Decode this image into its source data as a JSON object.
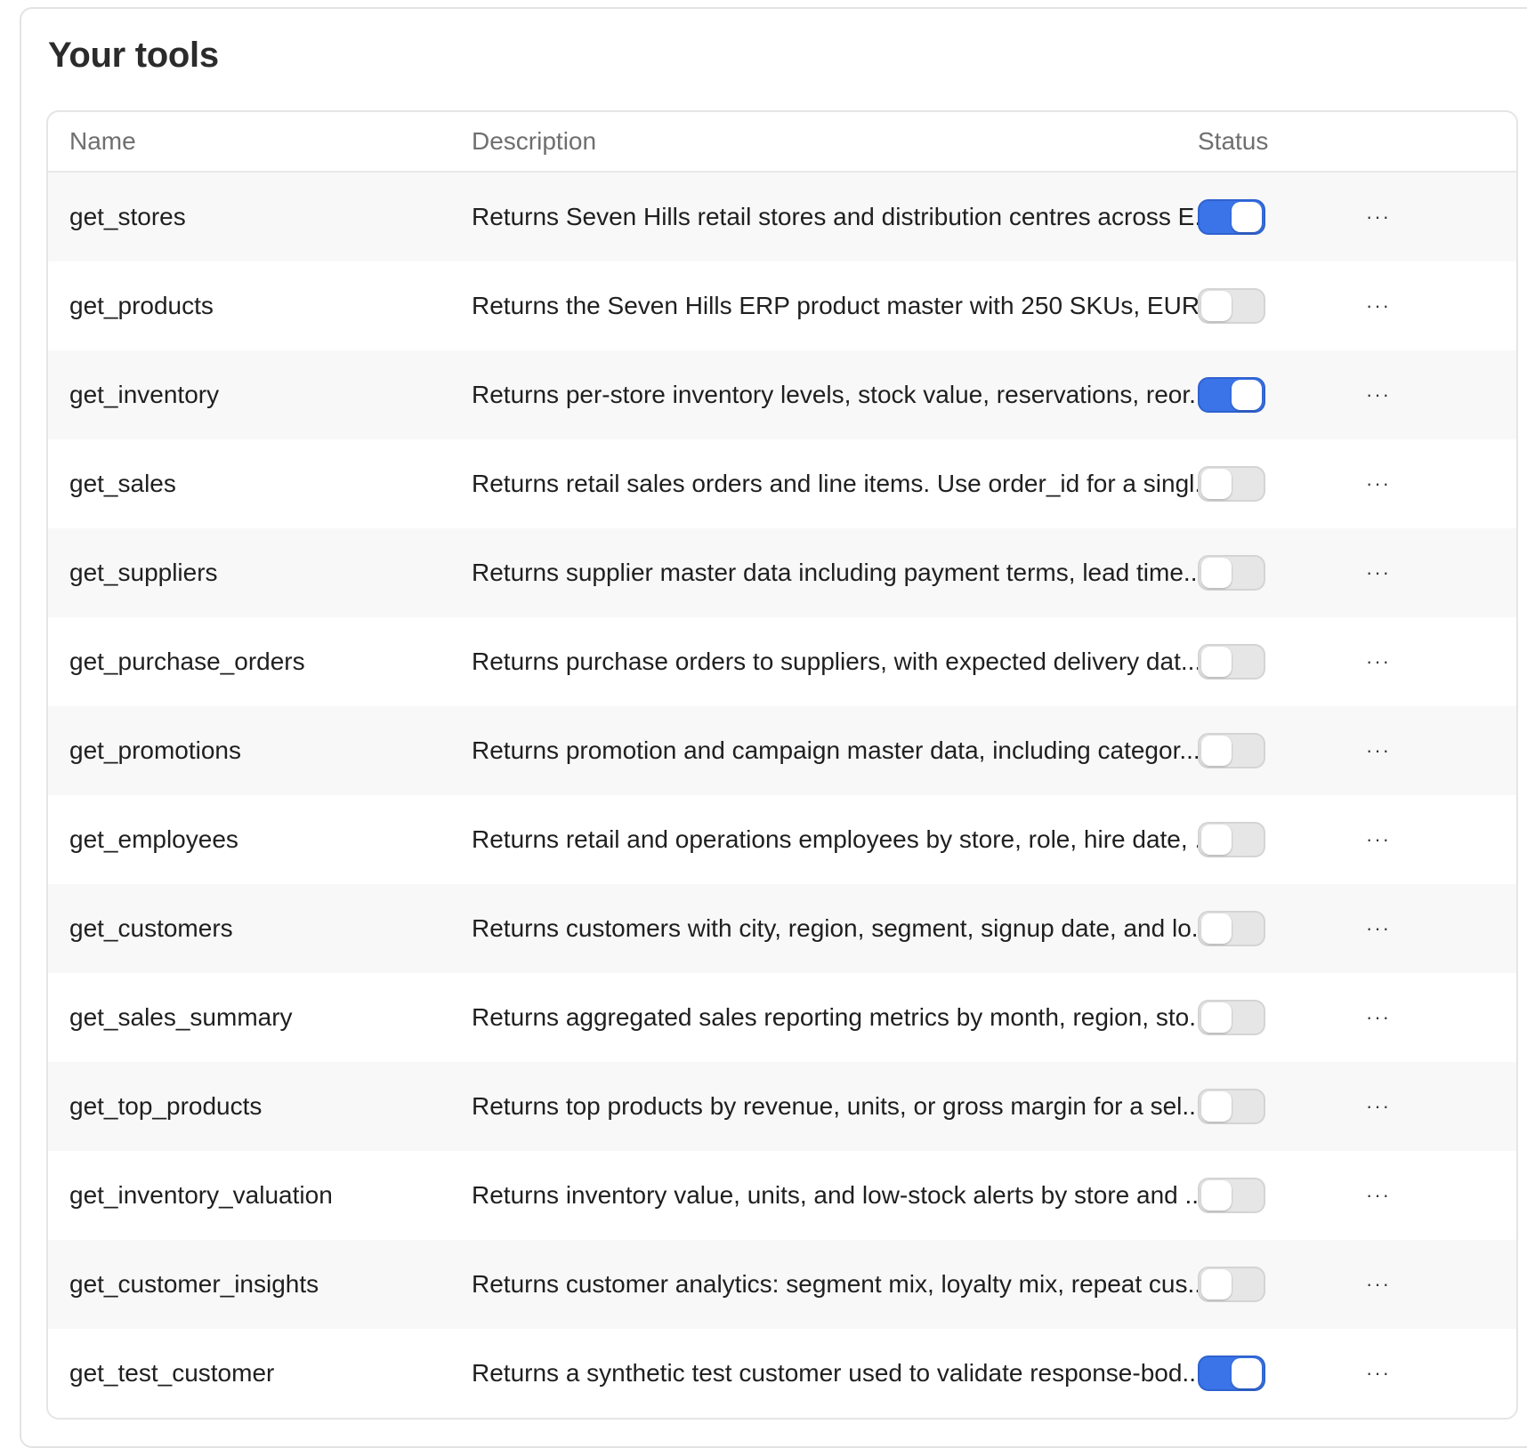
{
  "title": "Your tools",
  "columns": {
    "name": "Name",
    "description": "Description",
    "status": "Status"
  },
  "more_glyph": "···",
  "accent_color": "#3b73e8",
  "tools": [
    {
      "name": "get_stores",
      "description": "Returns Seven Hills retail stores and distribution centres across E...",
      "enabled": true
    },
    {
      "name": "get_products",
      "description": "Returns the Seven Hills ERP product master with 250 SKUs, EUR ...",
      "enabled": false
    },
    {
      "name": "get_inventory",
      "description": "Returns per-store inventory levels, stock value, reservations, reor...",
      "enabled": true
    },
    {
      "name": "get_sales",
      "description": "Returns retail sales orders and line items. Use order_id for a singl...",
      "enabled": false
    },
    {
      "name": "get_suppliers",
      "description": "Returns supplier master data including payment terms, lead time...",
      "enabled": false
    },
    {
      "name": "get_purchase_orders",
      "description": "Returns purchase orders to suppliers, with expected delivery dat...",
      "enabled": false
    },
    {
      "name": "get_promotions",
      "description": "Returns promotion and campaign master data, including categor...",
      "enabled": false
    },
    {
      "name": "get_employees",
      "description": "Returns retail and operations employees by store, role, hire date, ...",
      "enabled": false
    },
    {
      "name": "get_customers",
      "description": "Returns customers with city, region, segment, signup date, and lo...",
      "enabled": false
    },
    {
      "name": "get_sales_summary",
      "description": "Returns aggregated sales reporting metrics by month, region, sto...",
      "enabled": false
    },
    {
      "name": "get_top_products",
      "description": "Returns top products by revenue, units, or gross margin for a sel...",
      "enabled": false
    },
    {
      "name": "get_inventory_valuation",
      "description": "Returns inventory value, units, and low-stock alerts by store and ...",
      "enabled": false
    },
    {
      "name": "get_customer_insights",
      "description": "Returns customer analytics: segment mix, loyalty mix, repeat cus...",
      "enabled": false
    },
    {
      "name": "get_test_customer",
      "description": "Returns a synthetic test customer used to validate response-bod...",
      "enabled": true
    }
  ]
}
